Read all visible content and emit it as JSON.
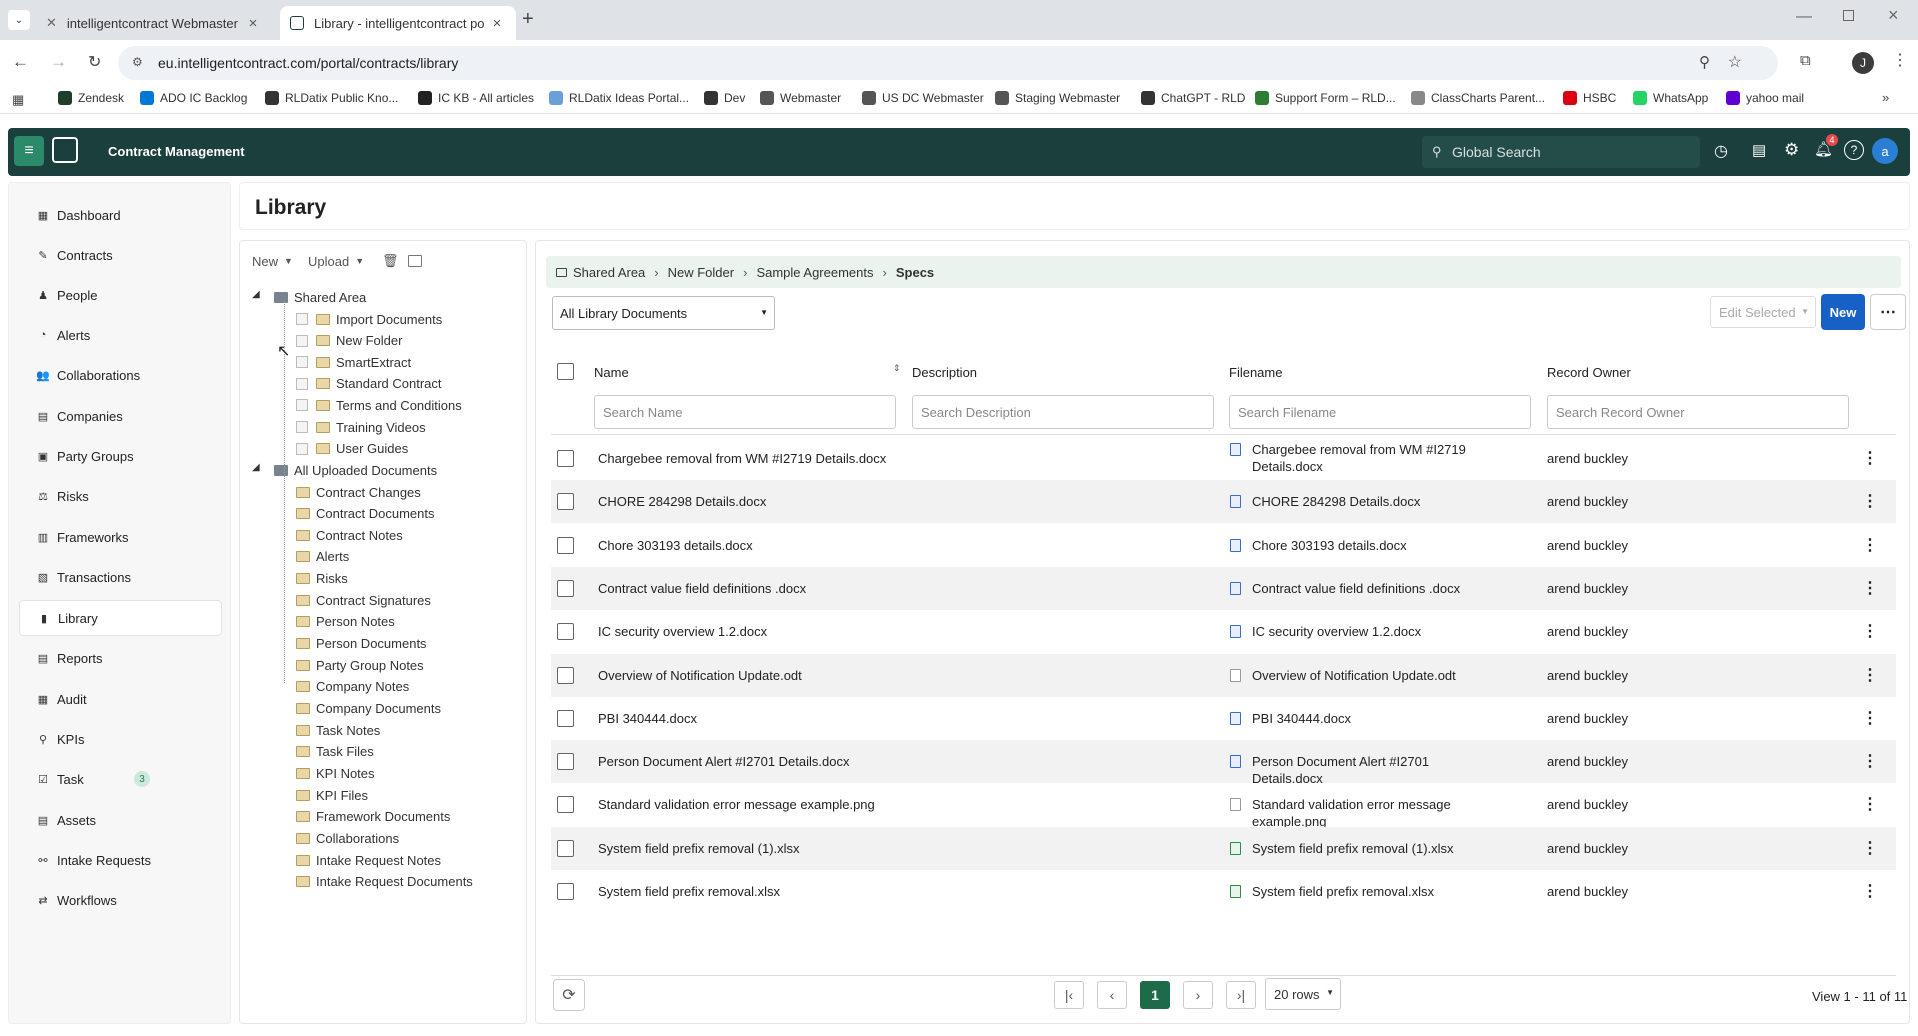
{
  "browser": {
    "tabs": [
      {
        "title": "intelligentcontract Webmaster"
      },
      {
        "title": "Library - intelligentcontract po"
      }
    ],
    "url": "eu.intelligentcontract.com/portal/contracts/library",
    "avatar_letter": "J",
    "bookmarks": [
      {
        "label": "Zendesk",
        "color": "#1f3d2a"
      },
      {
        "label": "ADO IC Backlog",
        "color": "#0078d4"
      },
      {
        "label": "RLDatix Public Kno...",
        "color": "#333"
      },
      {
        "label": "IC KB - All articles",
        "color": "#222"
      },
      {
        "label": "RLDatix Ideas Portal...",
        "color": "#6a9fd8"
      },
      {
        "label": "Dev",
        "color": "#333"
      },
      {
        "label": "Webmaster",
        "color": "#555"
      },
      {
        "label": "US DC Webmaster",
        "color": "#555"
      },
      {
        "label": "Staging Webmaster",
        "color": "#555"
      },
      {
        "label": "ChatGPT - RLD",
        "color": "#333"
      },
      {
        "label": "Support Form – RLD...",
        "color": "#2e7d32"
      },
      {
        "label": "ClassCharts Parent...",
        "color": "#888"
      },
      {
        "label": "HSBC",
        "color": "#db0011"
      },
      {
        "label": "WhatsApp",
        "color": "#25d366"
      },
      {
        "label": "yahoo mail",
        "color": "#5f01d1"
      }
    ]
  },
  "app": {
    "title": "Contract Management",
    "search_placeholder": "Global Search",
    "notification_count": "4",
    "user_letter": "a"
  },
  "sidebar": {
    "items": [
      {
        "label": "Dashboard",
        "icon": "dashboard-icon",
        "glyph": "▦"
      },
      {
        "label": "Contracts",
        "icon": "contracts-icon",
        "glyph": "✎"
      },
      {
        "label": "People",
        "icon": "people-icon",
        "glyph": "♟"
      },
      {
        "label": "Alerts",
        "icon": "alerts-icon",
        "glyph": "◔"
      },
      {
        "label": "Collaborations",
        "icon": "collaborations-icon",
        "glyph": "👥"
      },
      {
        "label": "Companies",
        "icon": "companies-icon",
        "glyph": "▤"
      },
      {
        "label": "Party Groups",
        "icon": "party-groups-icon",
        "glyph": "▣"
      },
      {
        "label": "Risks",
        "icon": "risks-icon",
        "glyph": "⚖"
      },
      {
        "label": "Frameworks",
        "icon": "frameworks-icon",
        "glyph": "▥"
      },
      {
        "label": "Transactions",
        "icon": "transactions-icon",
        "glyph": "▧"
      },
      {
        "label": "Library",
        "icon": "library-icon",
        "glyph": "▮"
      },
      {
        "label": "Reports",
        "icon": "reports-icon",
        "glyph": "▤"
      },
      {
        "label": "Audit",
        "icon": "audit-icon",
        "glyph": "▦"
      },
      {
        "label": "KPIs",
        "icon": "kpis-icon",
        "glyph": "⚲"
      },
      {
        "label": "Task",
        "icon": "task-icon",
        "glyph": "☑",
        "badge": "3"
      },
      {
        "label": "Assets",
        "icon": "assets-icon",
        "glyph": "▤"
      },
      {
        "label": "Intake Requests",
        "icon": "intake-requests-icon",
        "glyph": "⚯"
      },
      {
        "label": "Workflows",
        "icon": "workflows-icon",
        "glyph": "⇄"
      }
    ],
    "active": "Library"
  },
  "page": {
    "title": "Library"
  },
  "tree": {
    "toolbar": {
      "new_label": "New",
      "upload_label": "Upload"
    },
    "shared_root": "Shared Area",
    "shared_children": [
      "Import Documents",
      "New Folder",
      "SmartExtract",
      "Standard Contract",
      "Terms and Conditions",
      "Training Videos",
      "User Guides"
    ],
    "uploaded_root": "All Uploaded Documents",
    "uploaded_children": [
      "Contract Changes",
      "Contract Documents",
      "Contract Notes",
      "Alerts",
      "Risks",
      "Contract Signatures",
      "Person Notes",
      "Person Documents",
      "Party Group Notes",
      "Company Notes",
      "Company Documents",
      "Task Notes",
      "Task Files",
      "KPI Notes",
      "KPI Files",
      "Framework Documents",
      "Collaborations",
      "Intake Request Notes",
      "Intake Request Documents"
    ]
  },
  "grid": {
    "breadcrumb": [
      "Shared Area",
      "New Folder",
      "Sample Agreements",
      "Specs"
    ],
    "filter_value": "All Library Documents",
    "edit_selected_label": "Edit Selected",
    "new_label": "New",
    "columns": {
      "name": "Name",
      "description": "Description",
      "filename": "Filename",
      "owner": "Record Owner"
    },
    "search": {
      "name": "Search Name",
      "description": "Search Description",
      "filename": "Search Filename",
      "owner": "Search Record Owner"
    },
    "rows": [
      {
        "name": "Chargebee removal from WM #I2719 Details.docx",
        "filename": "Chargebee removal from WM #I2719 Details.docx",
        "type": "doc",
        "owner": "arend buckley"
      },
      {
        "name": "CHORE 284298 Details.docx",
        "filename": "CHORE 284298 Details.docx",
        "type": "doc",
        "owner": "arend buckley"
      },
      {
        "name": "Chore 303193 details.docx",
        "filename": "Chore 303193 details.docx",
        "type": "doc",
        "owner": "arend buckley"
      },
      {
        "name": "Contract value field definitions .docx",
        "filename": "Contract value field definitions .docx",
        "type": "doc",
        "owner": "arend buckley"
      },
      {
        "name": "IC security overview 1.2.docx",
        "filename": "IC security overview 1.2.docx",
        "type": "doc",
        "owner": "arend buckley"
      },
      {
        "name": "Overview of Notification Update.odt",
        "filename": "Overview of Notification Update.odt",
        "type": "file",
        "owner": "arend buckley"
      },
      {
        "name": "PBI 340444.docx",
        "filename": "PBI 340444.docx",
        "type": "doc",
        "owner": "arend buckley"
      },
      {
        "name": "Person Document Alert #I2701 Details.docx",
        "filename": "Person Document Alert #I2701 Details.docx",
        "type": "doc",
        "owner": "arend buckley"
      },
      {
        "name": "Standard validation error message example.png",
        "filename": "Standard validation error message example.png",
        "type": "file",
        "owner": "arend buckley"
      },
      {
        "name": "System field prefix removal (1).xlsx",
        "filename": "System field prefix removal (1).xlsx",
        "type": "xls",
        "owner": "arend buckley"
      },
      {
        "name": "System field prefix removal.xlsx",
        "filename": "System field prefix removal.xlsx",
        "type": "xls",
        "owner": "arend buckley"
      }
    ],
    "pager": {
      "current_page": "1",
      "rows_per_page": "20 rows",
      "view_text": "View 1 - 11 of 11"
    }
  }
}
